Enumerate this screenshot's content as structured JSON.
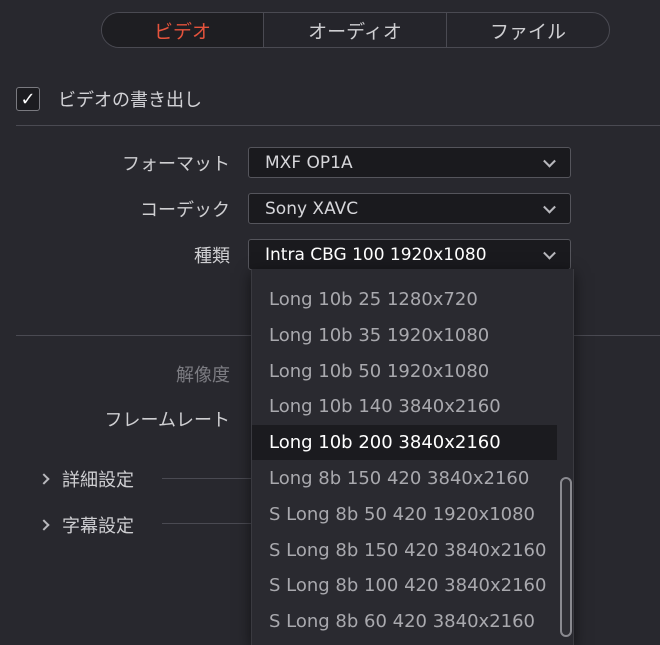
{
  "tabs": [
    {
      "label": "ビデオ",
      "active": true
    },
    {
      "label": "オーディオ",
      "active": false
    },
    {
      "label": "ファイル",
      "active": false
    }
  ],
  "export_video": {
    "label": "ビデオの書き出し",
    "checked": true,
    "checkmark": "✓"
  },
  "form": {
    "format": {
      "label": "フォーマット",
      "value": "MXF OP1A"
    },
    "codec": {
      "label": "コーデック",
      "value": "Sony XAVC"
    },
    "type": {
      "label": "種類",
      "value": "Intra CBG 100 1920x1080"
    },
    "resolution": {
      "label": "解像度"
    },
    "framerate": {
      "label": "フレームレート"
    }
  },
  "sections": {
    "advanced": "詳細設定",
    "subtitles": "字幕設定"
  },
  "dropdown": {
    "items": [
      "Long 10b 25 1280x720",
      "Long 10b 35 1920x1080",
      "Long 10b 50 1920x1080",
      "Long 10b 140 3840x2160",
      "Long 10b 200 3840x2160",
      "Long 8b 150 420 3840x2160",
      "S Long 8b 50 420 1920x1080",
      "S Long 8b 150 420 3840x2160",
      "S Long 8b 100 420 3840x2160",
      "S Long 8b 60 420 3840x2160"
    ],
    "selected_index": 4
  },
  "colors": {
    "accent": "#e5533c",
    "background": "#28282e",
    "field": "#1a1a1e"
  }
}
